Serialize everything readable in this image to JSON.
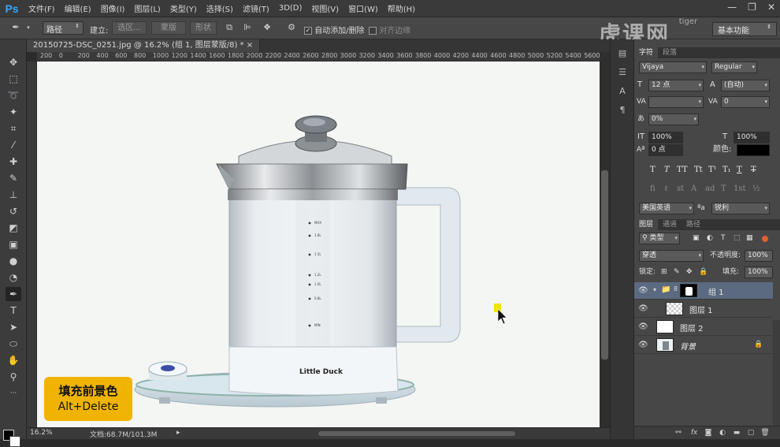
{
  "app": {
    "logo": "Ps",
    "window_controls": [
      "—",
      "❐",
      "✕"
    ]
  },
  "menu": [
    "文件(F)",
    "编辑(E)",
    "图像(I)",
    "图层(L)",
    "类型(Y)",
    "选择(S)",
    "滤镜(T)",
    "3D(D)",
    "视图(V)",
    "窗口(W)",
    "帮助(H)"
  ],
  "options": {
    "mode": "路径",
    "make_label": "建立:",
    "selection_btn": "选区...",
    "mask_btn": "蒙版",
    "shape_btn": "形状",
    "auto_add_delete": "自动添加/删除",
    "align_edges": "对齐边缘",
    "workspace": "基本功能"
  },
  "watermark": {
    "text": "虎课网",
    "tag": "tiger"
  },
  "document": {
    "tab_title": "20150725-DSC_0251.jpg @ 16.2% (组 1, 图层蒙版/8) *",
    "ruler_ticks": [
      "200",
      "0",
      "200",
      "400",
      "600",
      "800",
      "1000",
      "1200",
      "1400",
      "1600",
      "1800",
      "2000",
      "2200",
      "2400",
      "2600",
      "2800",
      "3000",
      "3200",
      "3400",
      "3600",
      "3800",
      "4000",
      "4200",
      "4400",
      "4600",
      "4800",
      "5000",
      "5200",
      "5400",
      "5600"
    ],
    "zoom": "16.2%",
    "doc_size": "文档:68.7M/101.3M"
  },
  "kettle": {
    "brand": "Little Duck",
    "marks": [
      "MAX",
      "1.8L",
      "1.5L",
      "1.2L",
      "1.0L",
      "0.8L",
      "MIN"
    ]
  },
  "callout": {
    "title": "填充前景色",
    "keys": "Alt+Delete"
  },
  "character_panel": {
    "tabs": [
      "字符",
      "段落"
    ],
    "font_family": "Vijaya",
    "font_style": "Regular",
    "size": "12 点",
    "leading": "(自动)",
    "kerning": "",
    "tracking": "0",
    "scale_pct": "0%",
    "vscale": "100%",
    "hscale": "100%",
    "baseline": "0 点",
    "color_label": "颜色:",
    "style_buttons": [
      "T",
      "T",
      "TT",
      "Tt",
      "T¹",
      "T₁",
      "T",
      "T"
    ],
    "opentype_buttons": [
      "fi",
      "ℓ",
      "st",
      "A",
      "ad",
      "T",
      "1st",
      "½"
    ],
    "language": "美国英语",
    "aa_label": "ªa",
    "antialias": "锐利"
  },
  "layers_panel": {
    "tabs": [
      "图层",
      "通道",
      "路径"
    ],
    "filter_kind": "类型",
    "blend_mode": "穿透",
    "opacity_label": "不透明度:",
    "opacity": "100%",
    "lock_label": "锁定:",
    "fill_label": "填充:",
    "fill": "100%",
    "layers": [
      {
        "name": "组 1",
        "selected": true
      },
      {
        "name": "图层 1",
        "selected": false
      },
      {
        "name": "图层 2",
        "selected": false
      },
      {
        "name": "背景",
        "selected": false
      }
    ]
  },
  "colors": {
    "accent": "#31a8ff",
    "callout": "#f0b400",
    "selected_layer": "#5b6a80"
  }
}
